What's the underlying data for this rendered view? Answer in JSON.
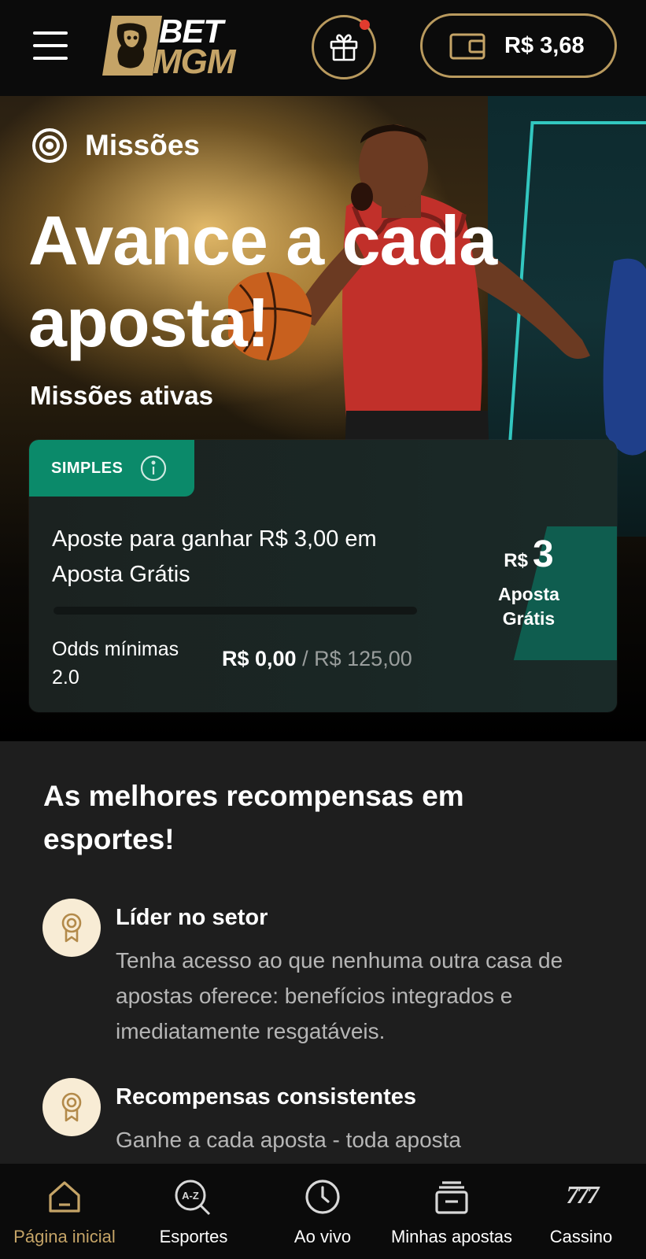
{
  "header": {
    "logo_top": "BET",
    "logo_bottom": "MGM",
    "balance": "R$ 3,68",
    "gift_has_notification": true
  },
  "hero": {
    "section_label": "Missões",
    "title": "Avance a cada aposta!",
    "active_missions_title": "Missões ativas"
  },
  "mission": {
    "badge": "SIMPLES",
    "description": "Aposte para ganhar R$ 3,00 em Aposta Grátis",
    "min_odds": "Odds mínimas 2.0",
    "progress_current": "R$ 0,00",
    "progress_separator": "/",
    "progress_target": "R$ 125,00",
    "progress_fraction": 0,
    "reward_currency": "R$",
    "reward_amount": "3",
    "reward_label": "Aposta Grátis"
  },
  "rewards": {
    "title": "As melhores recompensas em esportes!",
    "features": [
      {
        "title": "Líder no setor",
        "text": "Tenha acesso ao que nenhuma outra casa de apostas oferece: benefícios integrados e imediatamente resgatáveis."
      },
      {
        "title": "Recompensas consistentes",
        "text": "Ganhe a cada aposta - toda aposta"
      }
    ]
  },
  "nav": {
    "items": [
      {
        "label": "Página inicial",
        "icon": "home-icon",
        "active": true
      },
      {
        "label": "Esportes",
        "icon": "az-search-icon",
        "active": false
      },
      {
        "label": "Ao vivo",
        "icon": "clock-icon",
        "active": false
      },
      {
        "label": "Minhas apostas",
        "icon": "bet-slips-icon",
        "active": false
      },
      {
        "label": "Cassino",
        "icon": "slots-777-icon",
        "active": false
      }
    ]
  },
  "colors": {
    "gold": "#c5a467",
    "gold_border": "#b99a5e",
    "accent_green": "#0b8a6a",
    "notification_red": "#e23b2e",
    "background": "#1e1e1e",
    "header_bg": "#0b0b0b"
  }
}
